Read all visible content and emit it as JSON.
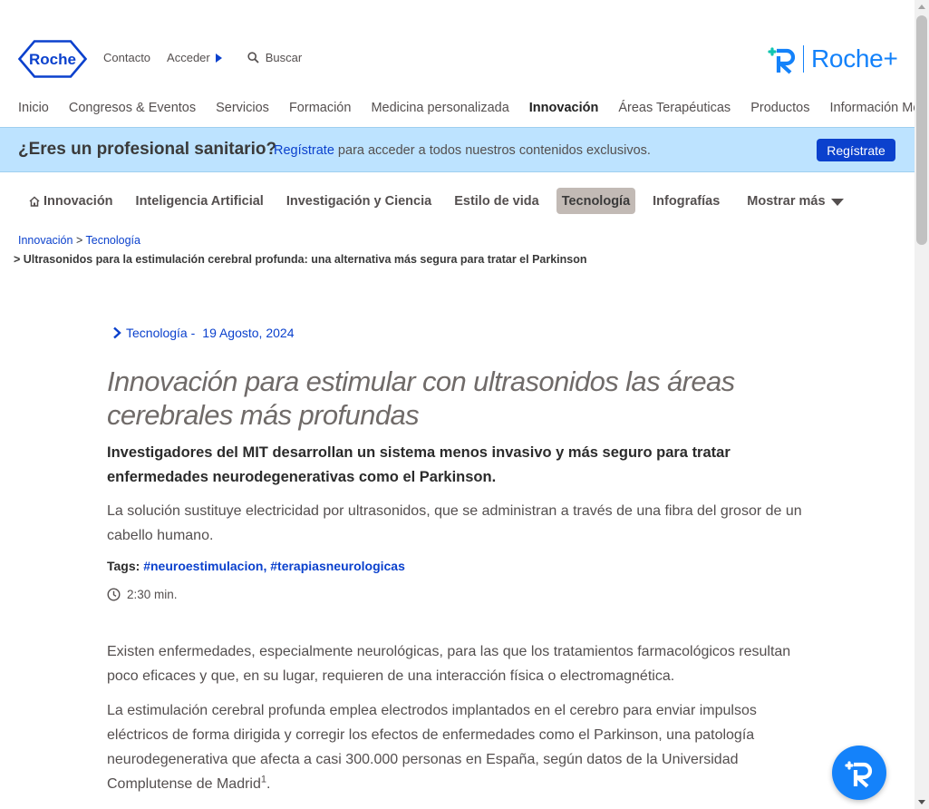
{
  "header": {
    "logo_text": "Roche",
    "links": {
      "contacto": "Contacto",
      "acceder": "Acceder",
      "buscar": "Buscar"
    },
    "brand_plus": "Roche+",
    "colors": {
      "brand_blue": "#0b41cd",
      "light_blue": "#1482fa"
    }
  },
  "main_nav": {
    "items": [
      {
        "label": "Inicio"
      },
      {
        "label": "Congresos & Eventos"
      },
      {
        "label": "Servicios"
      },
      {
        "label": "Formación"
      },
      {
        "label": "Medicina personalizada"
      },
      {
        "label": "Innovación",
        "active": true
      },
      {
        "label": "Áreas Terapéuticas"
      },
      {
        "label": "Productos"
      },
      {
        "label": "Información Médica"
      }
    ]
  },
  "banner": {
    "title": "¿Eres un profesional sanitario?",
    "link_text": "Regístrate",
    "text": " para acceder a todos nuestros contenidos exclusivos.",
    "button": "Regístrate",
    "bg_color": "#bde3ff"
  },
  "sub_nav": {
    "items": [
      {
        "label": "Innovación",
        "icon": "home-icon"
      },
      {
        "label": "Inteligencia Artificial"
      },
      {
        "label": "Investigación y Ciencia"
      },
      {
        "label": "Estilo de vida"
      },
      {
        "label": "Tecnología",
        "active": true
      },
      {
        "label": "Infografías"
      }
    ],
    "more": "Mostrar más"
  },
  "breadcrumb": {
    "root": "Innovación",
    "sep": ">",
    "section": "Tecnología",
    "current": "> Ultrasonidos para la estimulación cerebral profunda: una alternativa más segura para tratar el Parkinson"
  },
  "article": {
    "category": "Tecnología -",
    "date": "19 Agosto, 2024",
    "title": "Innovación para estimular con ultrasonidos las áreas cerebrales más profundas",
    "subtitle": "Investigadores del MIT desarrollan un sistema menos invasivo y más seguro para tratar enfermedades neurodegenerativas como el Parkinson.",
    "lead": "La solución sustituye electricidad por ultrasonidos, que se administran a través de una fibra del grosor de un cabello humano.",
    "tags_label": "Tags: ",
    "tags": [
      "#neuroestimulacion",
      "#terapiasneurologicas"
    ],
    "tag_sep": ", ",
    "read_time": "2:30 min.",
    "paragraph1": "Existen enfermedades, especialmente neurológicas, para las que los tratamientos farmacológicos resultan poco eficaces y que, en su lugar, requieren de una interacción física o electromagnética.",
    "paragraph2": "La estimulación cerebral profunda emplea electrodos implantados en el cerebro para enviar impulsos eléctricos de forma dirigida y corregir los efectos de enfermedades como el Parkinson, una patología neurodegenerativa que afecta a casi 300.000 personas en España, según datos de la Universidad Complutense de Madrid",
    "footnote": "1",
    "paragraph2_end": "."
  }
}
